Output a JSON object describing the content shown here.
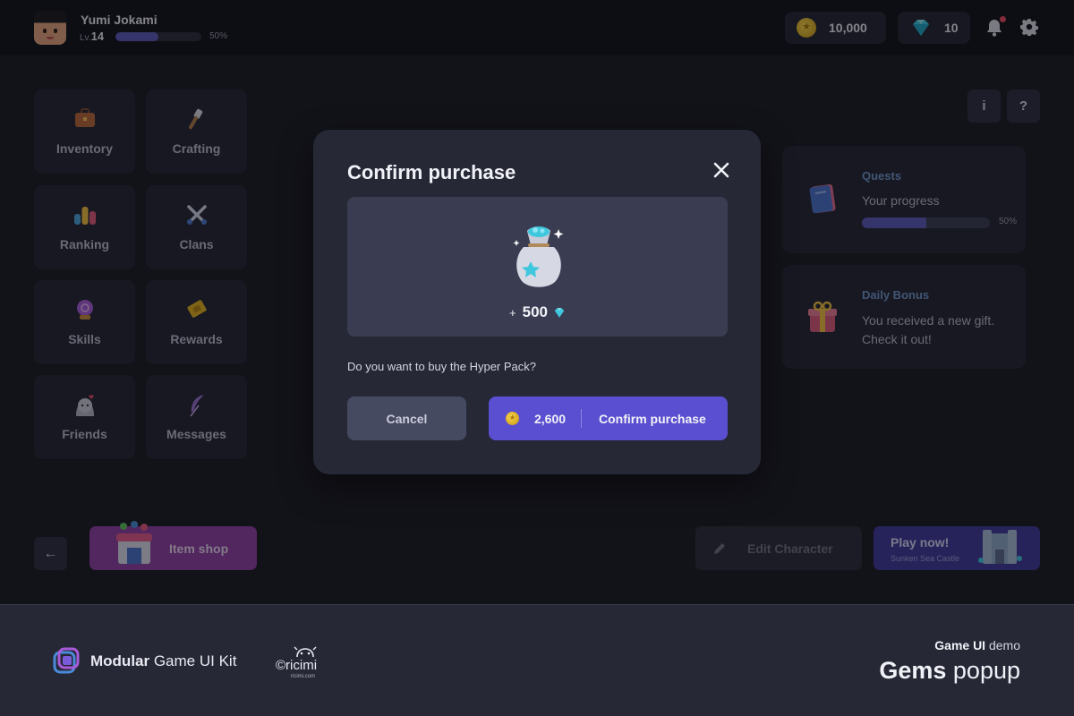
{
  "player": {
    "name": "Yumi Jokami",
    "level_prefix": "Lv.",
    "level": "14",
    "xp_progress": 0.5,
    "xp_label": "50%"
  },
  "currency": {
    "coins": "10,000",
    "gems": "10"
  },
  "menu": [
    {
      "label": "Inventory",
      "icon": "briefcase-icon"
    },
    {
      "label": "Crafting",
      "icon": "hammer-icon"
    },
    {
      "label": "Ranking",
      "icon": "ranking-bars-icon"
    },
    {
      "label": "Clans",
      "icon": "crossed-swords-icon"
    },
    {
      "label": "Skills",
      "icon": "crystal-ball-icon"
    },
    {
      "label": "Rewards",
      "icon": "ticket-icon"
    },
    {
      "label": "Friends",
      "icon": "friend-blob-icon"
    },
    {
      "label": "Messages",
      "icon": "feather-icon"
    }
  ],
  "info_buttons": {
    "info": "i",
    "help": "?"
  },
  "quests": {
    "title": "Quests",
    "subtitle": "Your progress",
    "progress": 0.5,
    "progress_label": "50%"
  },
  "daily_bonus": {
    "title": "Daily Bonus",
    "text_line1": "You received a new gift.",
    "text_line2": "Check it out!"
  },
  "bottom": {
    "back_icon": "arrow-left-icon",
    "item_shop": "Item shop",
    "edit_character": "Edit Character",
    "play_now": "Play now!",
    "play_location": "Sunken Sea Castle"
  },
  "modal": {
    "title": "Confirm purchase",
    "reward_prefix": "+",
    "reward_amount": "500",
    "question": "Do you want to buy the Hyper Pack?",
    "cancel": "Cancel",
    "price": "2,600",
    "confirm": "Confirm purchase"
  },
  "footer": {
    "kit_bold": "Modular",
    "kit_rest": " Game UI Kit",
    "brand": "©ricimi",
    "brand_url": "ricimi.com",
    "demo_bold": "Game UI",
    "demo_rest": " demo",
    "title_bold": "Gems",
    "title_rest": " popup"
  },
  "colors": {
    "accent": "#5a4fd0",
    "shop": "#8f3fa0",
    "play": "#3e3a9a",
    "link": "#6f96c8"
  }
}
